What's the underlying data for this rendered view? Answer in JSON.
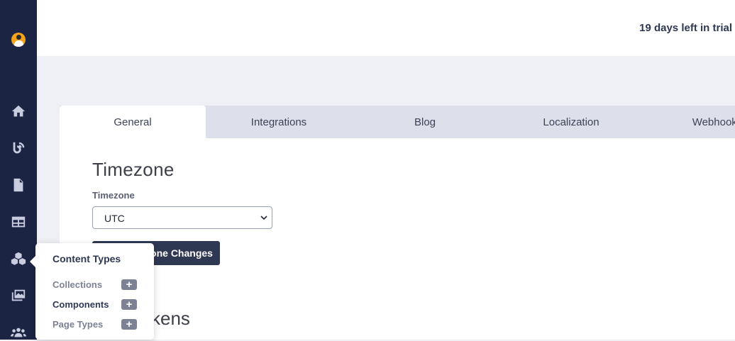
{
  "header": {
    "trial_text": "19 days left in trial"
  },
  "sidebar": {
    "icons": [
      "user-avatar",
      "home-icon",
      "blog-feed-icon",
      "document-icon",
      "table-icon",
      "cubes-icon",
      "media-icon",
      "users-icon"
    ]
  },
  "tabs": [
    {
      "label": "General",
      "active": true
    },
    {
      "label": "Integrations",
      "active": false
    },
    {
      "label": "Blog",
      "active": false
    },
    {
      "label": "Localization",
      "active": false
    },
    {
      "label": "Webhooks",
      "active": false
    }
  ],
  "timezone_section": {
    "title": "Timezone",
    "field_label": "Timezone",
    "selected_value": "UTC",
    "save_label": "one Changes"
  },
  "tokens_section": {
    "title_visible": "kens"
  },
  "popover": {
    "title": "Content Types",
    "items": [
      {
        "label": "Collections",
        "color": "#7c8194",
        "action": "+"
      },
      {
        "label": "Components",
        "color": "#2f3853",
        "action": "+"
      },
      {
        "label": "Page Types",
        "color": "#7c8194",
        "action": "+"
      }
    ]
  },
  "colors": {
    "sidebar": "#1c2444",
    "accent": "#2f3853",
    "avatar": "#f2a51c"
  }
}
